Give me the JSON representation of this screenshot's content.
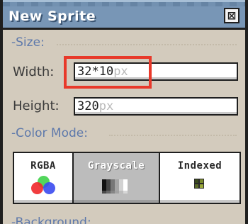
{
  "window": {
    "title": "New Sprite",
    "close_symbol": "⊠"
  },
  "size_section": {
    "label": "Size:"
  },
  "width": {
    "label": "Width:",
    "value": "32*10",
    "unit": "px"
  },
  "height": {
    "label": "Height:",
    "value": "320",
    "unit": "px"
  },
  "color_mode_section": {
    "label": "Color Mode:"
  },
  "color_modes": [
    {
      "label": "RGBA",
      "selected": false,
      "icon": "rgb-circles-icon"
    },
    {
      "label": "Grayscale",
      "selected": true,
      "icon": "gradient-icon"
    },
    {
      "label": "Indexed",
      "selected": false,
      "icon": "palette-grid-icon"
    }
  ],
  "background_section": {
    "label": "Background:"
  },
  "colors": {
    "titlebar": "#7896b6",
    "section": "#5e79ab",
    "dialog_bg": "#d3cbbd",
    "highlight": "#e8392a"
  }
}
